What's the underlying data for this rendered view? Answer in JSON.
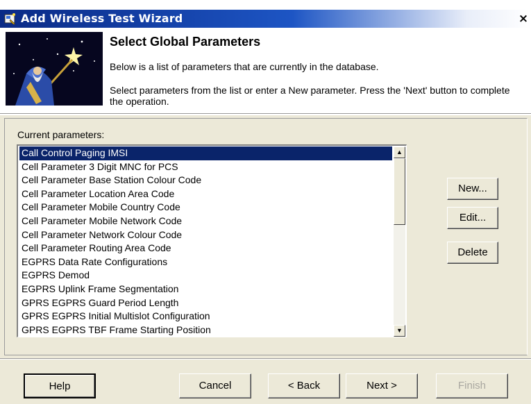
{
  "window": {
    "title": "Add Wireless Test Wizard",
    "close_label": "×"
  },
  "header": {
    "title": "Select Global Parameters",
    "description": "Below is a list of parameters that are currently in the database.",
    "instructions": "Select parameters from the list or enter a New parameter.  Press the 'Next' button to complete the operation."
  },
  "parameters": {
    "label": "Current parameters:",
    "items": [
      "Call Control Paging IMSI",
      "Cell Parameter 3 Digit MNC for PCS",
      "Cell Parameter Base Station Colour Code",
      "Cell Parameter Location Area Code",
      "Cell Parameter Mobile Country Code",
      "Cell Parameter Mobile Network Code",
      "Cell Parameter Network Colour Code",
      "Cell Parameter Routing Area Code",
      "EGPRS Data Rate Configurations",
      "EGPRS Demod",
      "EGPRS Uplink Frame Segmentation",
      "GPRS EGPRS Guard Period Length",
      "GPRS EGPRS Initial Multislot Configuration",
      "GPRS EGPRS TBF Frame Starting Position"
    ],
    "selected_index": 0
  },
  "side_buttons": {
    "new_label": "New...",
    "edit_label": "Edit...",
    "delete_label": "Delete"
  },
  "footer": {
    "help_label": "Help",
    "cancel_label": "Cancel",
    "back_label": "< Back",
    "next_label": "Next >",
    "finish_label": "Finish"
  },
  "colors": {
    "titlebar_start": "#0a2a86",
    "selection": "#0a246a",
    "face": "#ece9d8"
  }
}
